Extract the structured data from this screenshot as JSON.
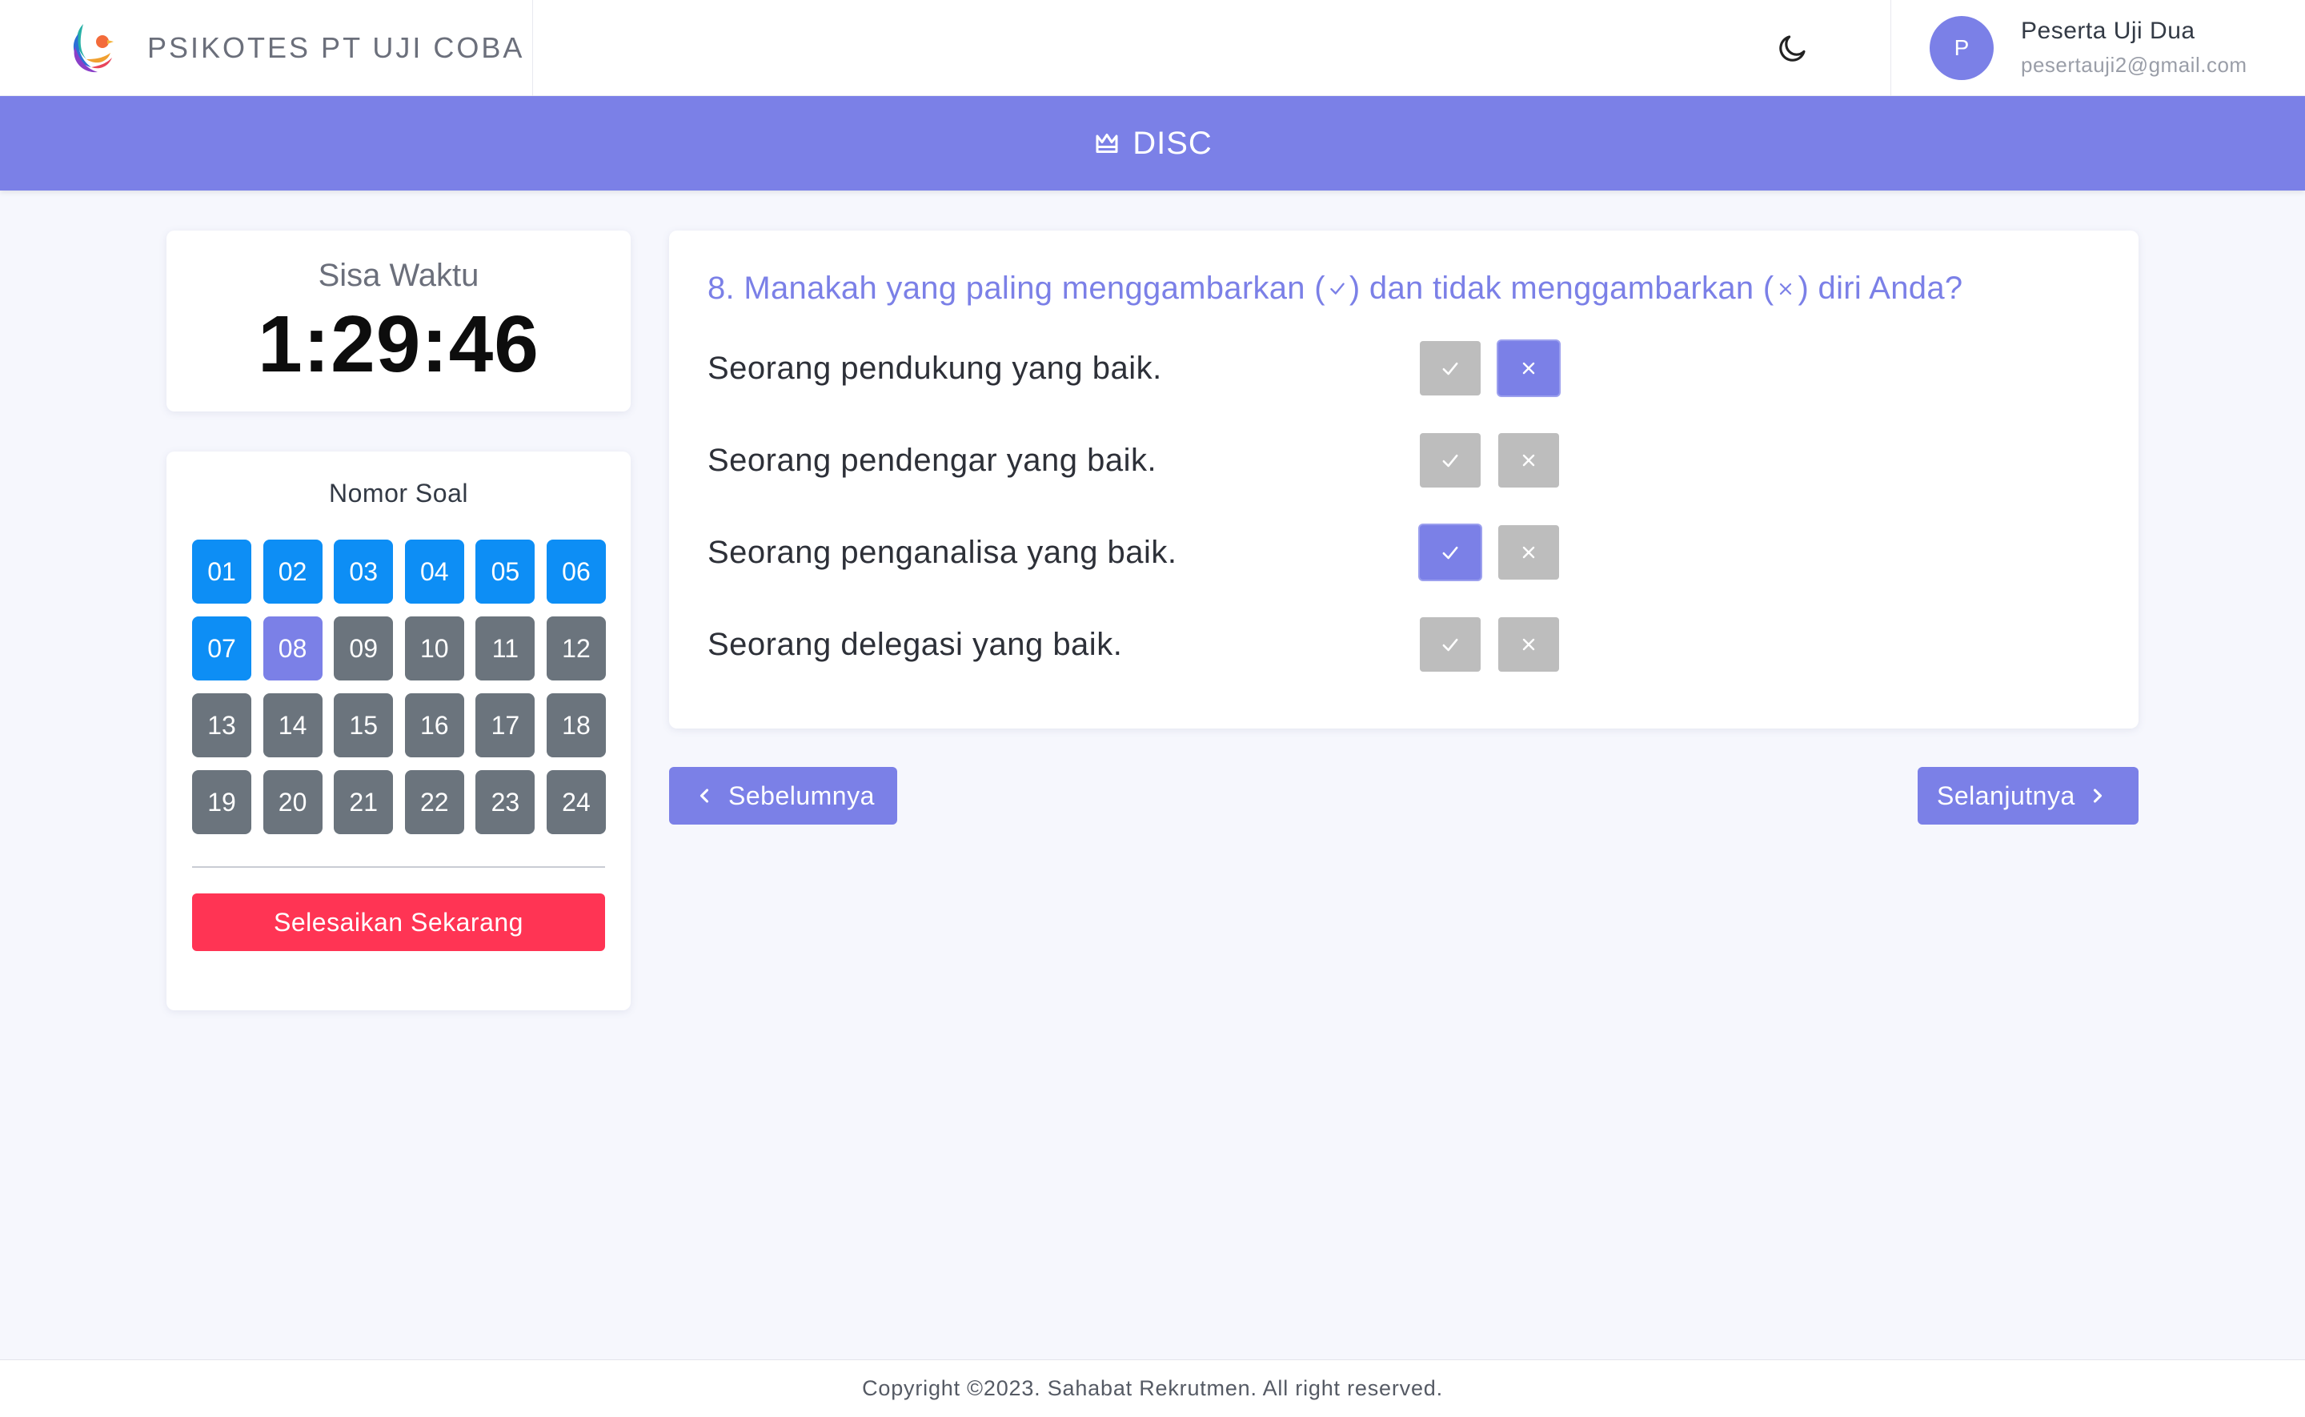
{
  "header": {
    "brand_name": "PSIKOTES PT UJI COBA",
    "user": {
      "initial": "P",
      "name": "Peserta Uji Dua",
      "email": "pesertauji2@gmail.com"
    }
  },
  "banner": {
    "title": "DISC"
  },
  "timer": {
    "label": "Sisa Waktu",
    "value": "1:29:46"
  },
  "navigator": {
    "title": "Nomor Soal",
    "numbers": [
      {
        "label": "01",
        "status": "answered"
      },
      {
        "label": "02",
        "status": "answered"
      },
      {
        "label": "03",
        "status": "answered"
      },
      {
        "label": "04",
        "status": "answered"
      },
      {
        "label": "05",
        "status": "answered"
      },
      {
        "label": "06",
        "status": "answered"
      },
      {
        "label": "07",
        "status": "answered"
      },
      {
        "label": "08",
        "status": "current"
      },
      {
        "label": "09",
        "status": "pending"
      },
      {
        "label": "10",
        "status": "pending"
      },
      {
        "label": "11",
        "status": "pending"
      },
      {
        "label": "12",
        "status": "pending"
      },
      {
        "label": "13",
        "status": "pending"
      },
      {
        "label": "14",
        "status": "pending"
      },
      {
        "label": "15",
        "status": "pending"
      },
      {
        "label": "16",
        "status": "pending"
      },
      {
        "label": "17",
        "status": "pending"
      },
      {
        "label": "18",
        "status": "pending"
      },
      {
        "label": "19",
        "status": "pending"
      },
      {
        "label": "20",
        "status": "pending"
      },
      {
        "label": "21",
        "status": "pending"
      },
      {
        "label": "22",
        "status": "pending"
      },
      {
        "label": "23",
        "status": "pending"
      },
      {
        "label": "24",
        "status": "pending"
      }
    ],
    "finish_label": "Selesaikan Sekarang"
  },
  "question": {
    "prefix": "8. Manakah yang paling menggambarkan (",
    "middle": ") dan tidak menggambarkan (",
    "suffix": ") diri Anda?",
    "statements": [
      {
        "text": "Seorang pendukung yang baik.",
        "most": false,
        "least": true
      },
      {
        "text": "Seorang pendengar yang baik.",
        "most": false,
        "least": false
      },
      {
        "text": "Seorang penganalisa yang baik.",
        "most": true,
        "least": false
      },
      {
        "text": "Seorang delegasi yang baik.",
        "most": false,
        "least": false
      }
    ]
  },
  "navigation": {
    "prev_label": "Sebelumnya",
    "next_label": "Selanjutnya"
  },
  "footer": {
    "text": "Copyright ©2023. Sahabat Rekrutmen. All right reserved."
  },
  "colors": {
    "accent": "#7b80e7",
    "answered": "#0d8ef5",
    "pending": "#6b747d",
    "danger": "#ff3454",
    "option_idle": "#bdbdbd"
  }
}
